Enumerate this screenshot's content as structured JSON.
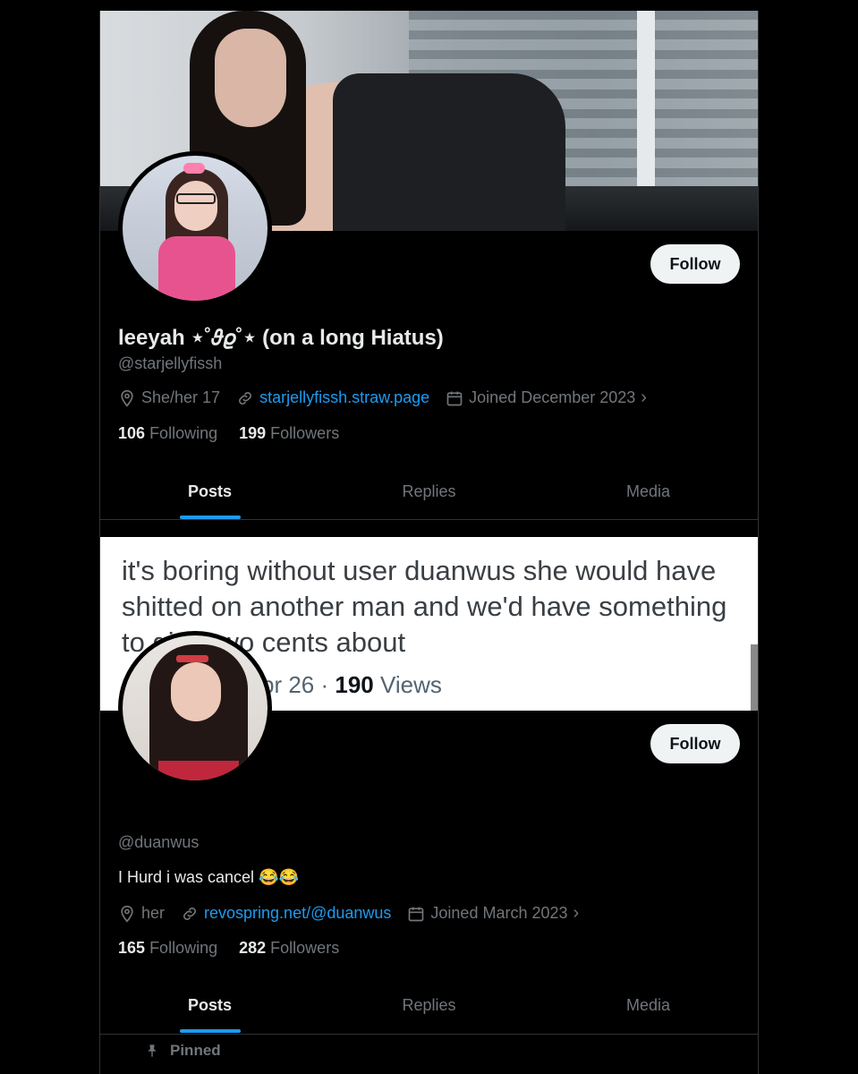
{
  "profile1": {
    "name": "leeyah ⋆˚𝜗𝜚˚⋆ (on a long Hiatus)",
    "handle": "@starjellyfissh",
    "follow_label": "Follow",
    "meta": {
      "location": "She/her 17",
      "link": "starjellyfissh.straw.page",
      "joined": "Joined December 2023"
    },
    "following_count": "106",
    "following_label": "Following",
    "followers_count": "199",
    "followers_label": "Followers",
    "tabs": [
      "Posts",
      "Replies",
      "Media"
    ]
  },
  "insert": {
    "text": "it's boring without user duanwus she would have  shitted on another man and we'd have something to give two cents about",
    "views_prefix": "pr 26 · ",
    "views_count": "190",
    "views_label": " Views"
  },
  "profile2": {
    "handle": "@duanwus",
    "bio": "I Hurd i was cancel 😂😂",
    "follow_label": "Follow",
    "meta": {
      "location": "her",
      "link": "revospring.net/@duanwus",
      "joined": "Joined March 2023"
    },
    "following_count": "165",
    "following_label": "Following",
    "followers_count": "282",
    "followers_label": "Followers",
    "tabs": [
      "Posts",
      "Replies",
      "Media"
    ],
    "pinned_label": "Pinned"
  },
  "colors": {
    "accent": "#1d9bf0",
    "background": "#000000",
    "muted": "#71767b",
    "text": "#e7e9ea"
  },
  "icons": [
    "location-icon",
    "link-icon",
    "calendar-icon",
    "chevron-right-icon",
    "pin-icon"
  ]
}
